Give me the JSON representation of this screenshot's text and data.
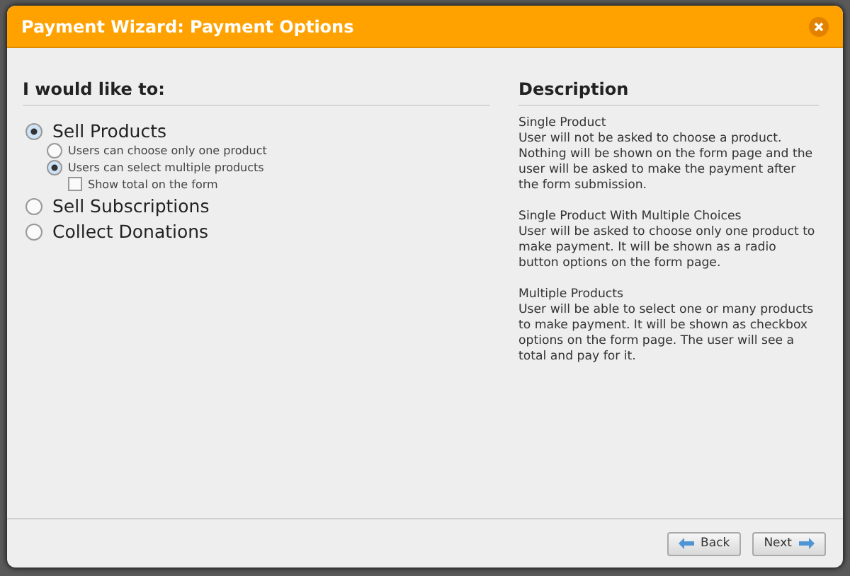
{
  "window": {
    "title": "Payment Wizard: Payment Options"
  },
  "options": {
    "heading": "I would like to:",
    "items": [
      {
        "kind": "radio",
        "label": "Sell Products",
        "selected": true,
        "children": [
          {
            "kind": "radio",
            "label": "Users can choose only one product",
            "selected": false
          },
          {
            "kind": "radio",
            "label": "Users can select multiple products",
            "selected": true,
            "children": [
              {
                "kind": "checkbox",
                "label": "Show total on the form",
                "checked": false
              }
            ]
          }
        ]
      },
      {
        "kind": "radio",
        "label": "Sell Subscriptions",
        "selected": false
      },
      {
        "kind": "radio",
        "label": "Collect Donations",
        "selected": false
      }
    ]
  },
  "description": {
    "heading": "Description",
    "sections": [
      {
        "title": "Single Product",
        "text": "User will not be asked to choose a product. Nothing will be shown on the form page and the user will be asked to make the payment after the form submission."
      },
      {
        "title": "Single Product With Multiple Choices",
        "text": "User will be asked to choose only one product to make payment. It will be shown as a radio button options on the form page."
      },
      {
        "title": "Multiple Products",
        "text": "User will be able to select one or many products to make payment. It will be shown as checkbox options on the form page. The user will see a total and pay for it."
      }
    ]
  },
  "buttons": [
    {
      "kind": "back",
      "label": "Back"
    },
    {
      "kind": "next",
      "label": "Next"
    }
  ]
}
